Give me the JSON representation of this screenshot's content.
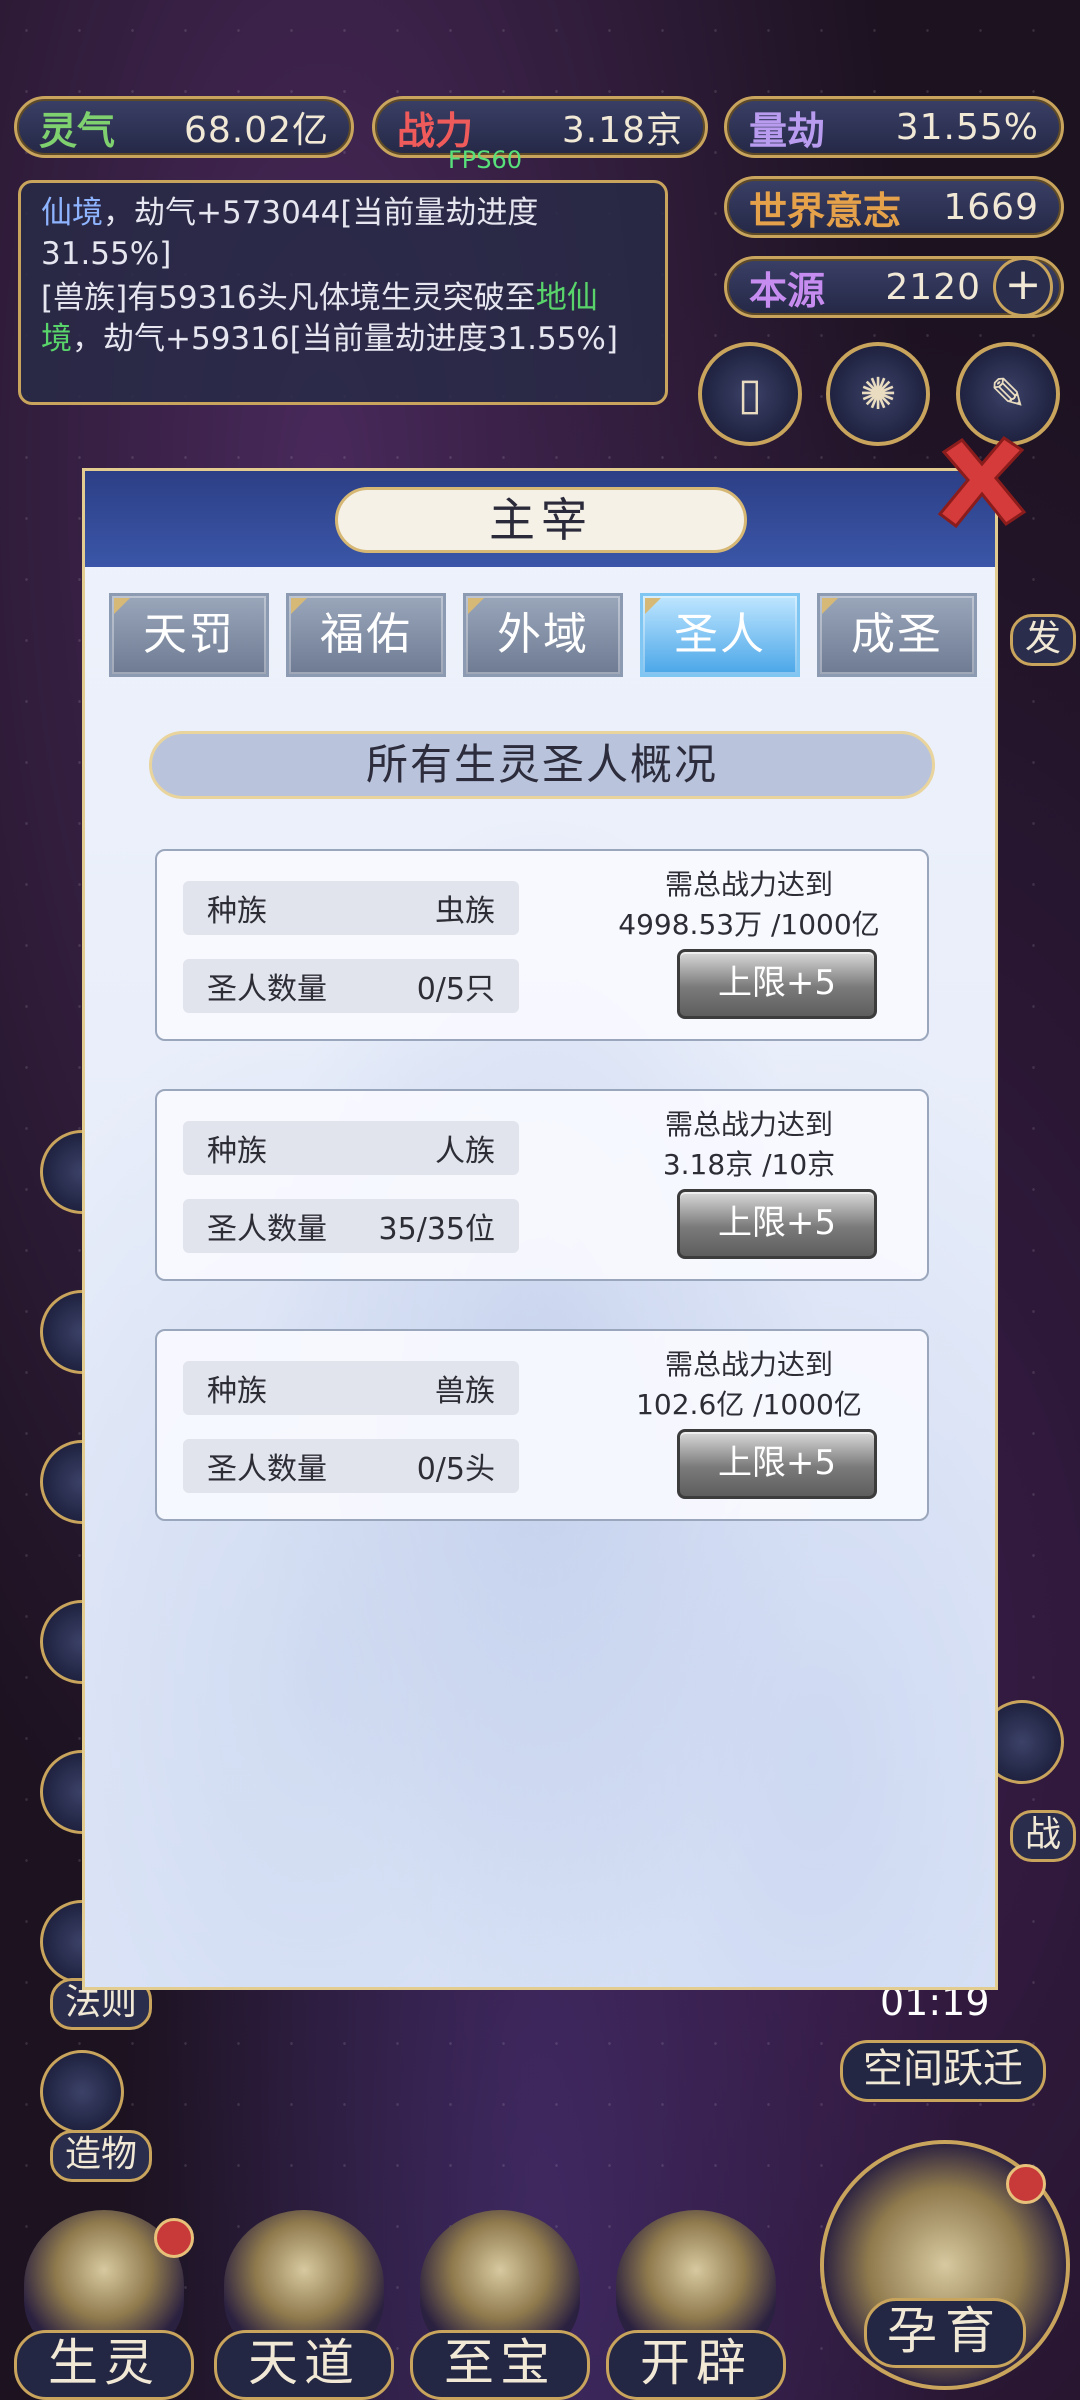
{
  "resources": {
    "lingqi": {
      "label": "灵气",
      "value": "68.02亿"
    },
    "zhanli": {
      "label": "战力",
      "value": "3.18京"
    },
    "liangjie": {
      "label": "量劫",
      "value": "31.55%"
    },
    "shijie": {
      "label": "世界意志",
      "value": "1669"
    },
    "benyuan": {
      "label": "本源",
      "value": "2120"
    }
  },
  "fps": "FPS60",
  "log": {
    "line1_a": "仙境",
    "line1_b": "，劫气+573044[当前量劫进度31.55%]",
    "line2_a": "[兽族]有59316头凡体境生灵突破至",
    "line2_b": "地仙境",
    "line2_c": "，劫气+59316[当前量劫进度31.55%]"
  },
  "side_labels": {
    "fa": "发",
    "zhan": "战",
    "faze": "法则",
    "zaowu": "造物"
  },
  "timer": {
    "time": "01:19",
    "label": "空间跃迁"
  },
  "bottom_nav": [
    "生灵",
    "天道",
    "至宝",
    "开辟",
    "孕育"
  ],
  "modal": {
    "title": "主宰",
    "tabs": [
      "天罚",
      "福佑",
      "外域",
      "圣人",
      "成圣"
    ],
    "active_tab": "圣人",
    "overview_title": "所有生灵圣人概况",
    "cards": [
      {
        "race_label": "种族",
        "race": "虫族",
        "count_label": "圣人数量",
        "count": "0/5只",
        "req_label": "需总战力达到",
        "req_value": "4998.53万 /1000亿",
        "button": "上限+5"
      },
      {
        "race_label": "种族",
        "race": "人族",
        "count_label": "圣人数量",
        "count": "35/35位",
        "req_label": "需总战力达到",
        "req_value": "3.18京 /10京",
        "button": "上限+5"
      },
      {
        "race_label": "种族",
        "race": "兽族",
        "count_label": "圣人数量",
        "count": "0/5头",
        "req_label": "需总战力达到",
        "req_value": "102.6亿 /1000亿",
        "button": "上限+5"
      }
    ]
  }
}
